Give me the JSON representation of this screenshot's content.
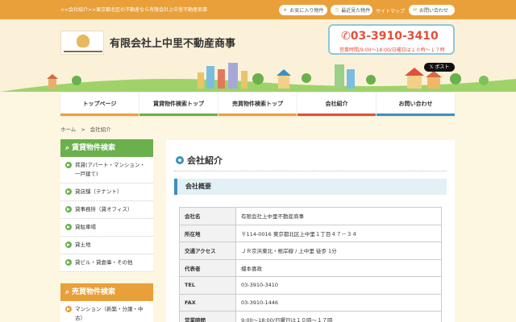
{
  "topbar": {
    "tagline": "<<会社紹介>>東京都北区の不動産なら有限会社上中里不動産商事",
    "favorites": "お気に入り物件",
    "recent": "最近見た物件",
    "sitemap": "サイトマップ",
    "contact": "お問い合わせ"
  },
  "header": {
    "company_name": "有限会社上中里不動産商事",
    "phone": "03-3910-3410",
    "hours": "営業時間/9:00〜18:00/日曜日は１０時〜１７時",
    "x_post": "ポスト"
  },
  "nav": [
    {
      "label": "トップページ",
      "color": "#e9a03a"
    },
    {
      "label": "賃貸物件検索トップ",
      "color": "#6ab04c"
    },
    {
      "label": "売買物件検索トップ",
      "color": "#e9a03a"
    },
    {
      "label": "会社紹介",
      "color": "#e0503a"
    },
    {
      "label": "お問い合わせ",
      "color": "#3d8fbf"
    }
  ],
  "breadcrumb": {
    "home": "ホーム",
    "sep": ">",
    "current": "会社紹介"
  },
  "sidebar": {
    "rental": {
      "title": "賃貸物件検索",
      "color": "#6ab04c",
      "items": [
        "賃貸(アパート・マンション・一戸建て)",
        "貸店舗（テナント）",
        "貸事務所（貸オフィス）",
        "貸駐車場",
        "貸土地",
        "貸ビル・貸倉庫・その他"
      ]
    },
    "sale": {
      "title": "売買物件検索",
      "color": "#e9a03a",
      "items": [
        "マンション（新築・分譲・中古）"
      ]
    }
  },
  "main": {
    "title": "会社紹介",
    "subheading": "会社概要",
    "rows": [
      {
        "key": "会社名",
        "value": "有限会社上中里不動産商事"
      },
      {
        "key": "所在地",
        "value": "〒114-0016 東京都北区上中里１丁目４７－３４"
      },
      {
        "key": "交通アクセス",
        "value": "ＪＲ京浜東北・根岸線 / 上中里 徒歩 1分"
      },
      {
        "key": "代表者",
        "value": "榎本喜政"
      },
      {
        "key": "TEL",
        "value": "03-3910-3410"
      },
      {
        "key": "FAX",
        "value": "03-3910-1446"
      },
      {
        "key": "営業時間",
        "value": "9:00〜18:00/日曜日は１０時〜１７時"
      }
    ]
  }
}
